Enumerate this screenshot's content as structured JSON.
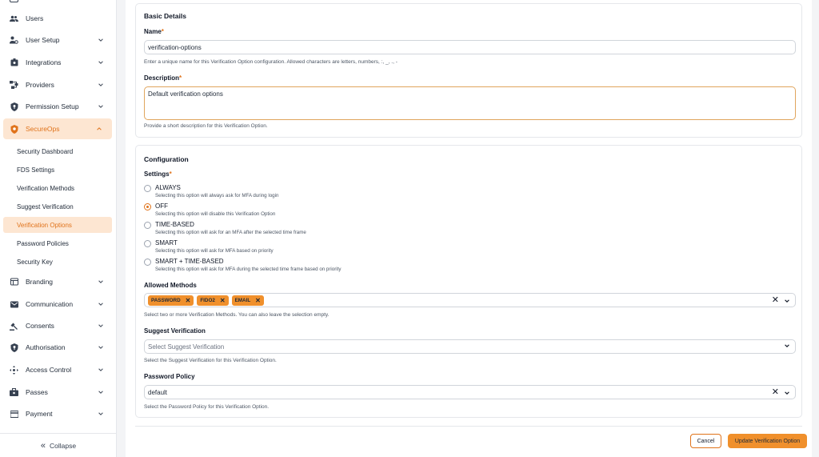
{
  "sidebar": {
    "items": [
      {
        "label": "Users",
        "icon": "users-icon"
      },
      {
        "label": "User Setup",
        "icon": "user-setup-icon"
      },
      {
        "label": "Integrations",
        "icon": "integrations-icon"
      },
      {
        "label": "Providers",
        "icon": "providers-icon"
      },
      {
        "label": "Permission Setup",
        "icon": "permission-icon"
      },
      {
        "label": "SecureOps",
        "icon": "shield-icon"
      }
    ],
    "subitems": [
      {
        "label": "Security Dashboard"
      },
      {
        "label": "FDS Settings"
      },
      {
        "label": "Verification Methods"
      },
      {
        "label": "Suggest Verification"
      },
      {
        "label": "Verification Options"
      },
      {
        "label": "Password Policies"
      },
      {
        "label": "Security Key"
      }
    ],
    "items_bottom": [
      {
        "label": "Branding",
        "icon": "branding-icon"
      },
      {
        "label": "Communication",
        "icon": "mail-icon"
      },
      {
        "label": "Consents",
        "icon": "gavel-icon"
      },
      {
        "label": "Authorisation",
        "icon": "authorisation-icon"
      },
      {
        "label": "Access Control",
        "icon": "access-control-icon"
      },
      {
        "label": "Passes",
        "icon": "passes-icon"
      },
      {
        "label": "Payment",
        "icon": "payment-icon"
      }
    ],
    "collapse_label": "Collapse",
    "accent_color": "#e0731b"
  },
  "basic": {
    "title": "Basic Details",
    "name_label": "Name",
    "name_value": "verification-options",
    "name_help": "Enter a unique name for this Verification Option configuration. Allowed characters are letters, numbers, :, _, ., -",
    "desc_label": "Description",
    "desc_value": "Default verification options",
    "desc_help": "Provide a short description for this Verification Option."
  },
  "config": {
    "title": "Configuration",
    "settings_label": "Settings",
    "options": [
      {
        "title": "ALWAYS",
        "desc": "Selecting this option will always ask for MFA during login",
        "checked": false
      },
      {
        "title": "OFF",
        "desc": "Selecting this option will disable this Verification Option",
        "checked": true
      },
      {
        "title": "TIME-BASED",
        "desc": "Selecting this option will ask for an MFA after the selected time frame",
        "checked": false
      },
      {
        "title": "SMART",
        "desc": "Selecting this option will ask for MFA based on priority",
        "checked": false
      },
      {
        "title": "SMART + TIME-BASED",
        "desc": "Selecting this option will ask for MFA during the selected time frame based on priority",
        "checked": false
      }
    ],
    "methods_label": "Allowed Methods",
    "methods": [
      "PASSWORD",
      "FIDO2",
      "EMAIL"
    ],
    "methods_help": "Select two or more Verification Methods. You can also leave the selection empty.",
    "suggest_label": "Suggest Verification",
    "suggest_placeholder": "Select Suggest Verification",
    "suggest_help": "Select the Suggest Verification for this Verification Option.",
    "policy_label": "Password Policy",
    "policy_value": "default",
    "policy_help": "Select the Password Policy for this Verification Option."
  },
  "footer": {
    "cancel_label": "Cancel",
    "submit_label": "Update Verification Option"
  }
}
